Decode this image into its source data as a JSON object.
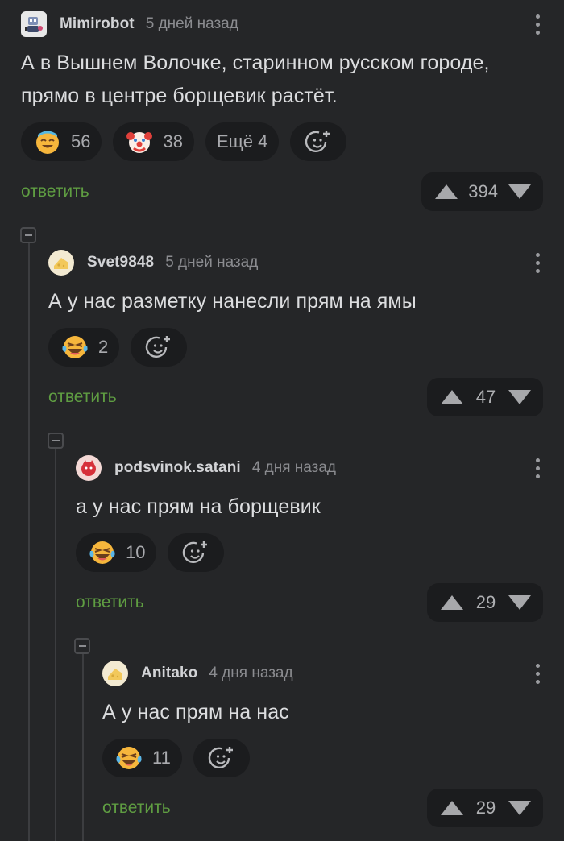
{
  "comments": [
    {
      "author": "Mimirobot",
      "time": "5 дней назад",
      "text": "А в Вышнем Волочке, старинном русском городе, прямо в центре борщевик растёт.",
      "reactions": [
        {
          "icon": "smiling-sweat-emoji",
          "count": "56"
        },
        {
          "icon": "clown-emoji",
          "count": "38"
        }
      ],
      "more_label": "Ещё 4",
      "reply_label": "ответить",
      "score": "394"
    },
    {
      "author": "Svet9848",
      "time": "5 дней назад",
      "text": "А у нас разметку нанесли прям на ямы",
      "reactions": [
        {
          "icon": "laughing-tears-emoji",
          "count": "2"
        }
      ],
      "reply_label": "ответить",
      "score": "47"
    },
    {
      "author": "podsvinok.satani",
      "time": "4 дня назад",
      "text": "а у нас прям на борщевик",
      "reactions": [
        {
          "icon": "laughing-tears-emoji",
          "count": "10"
        }
      ],
      "reply_label": "ответить",
      "score": "29"
    },
    {
      "author": "Anitako",
      "time": "4 дня назад",
      "text": "А у нас прям на нас",
      "reactions": [
        {
          "icon": "laughing-tears-emoji",
          "count": "11"
        }
      ],
      "reply_label": "ответить",
      "score": "29"
    }
  ],
  "colors": {
    "background": "#252628",
    "pill": "#1b1c1e",
    "reply": "#5f9d42",
    "muted": "#8b8c90"
  }
}
